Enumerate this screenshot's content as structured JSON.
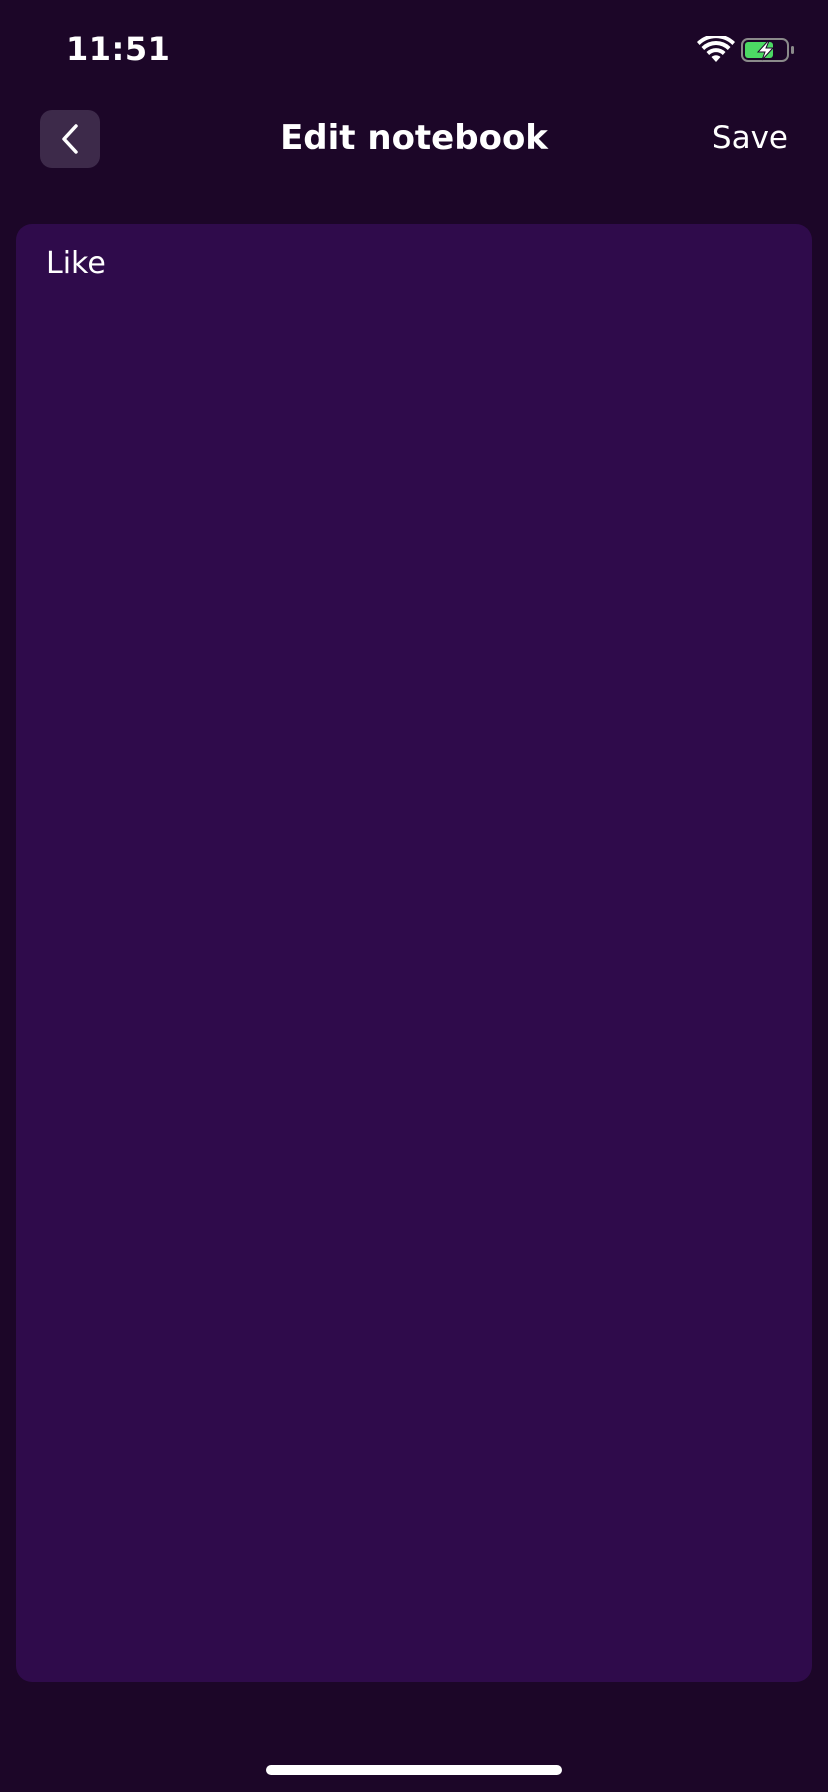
{
  "status_bar": {
    "time": "11:51",
    "wifi_icon": "wifi-icon",
    "battery_icon": "battery-charging-icon",
    "battery_color": "#4cd964"
  },
  "nav": {
    "back_icon": "chevron-left-icon",
    "title": "Edit notebook",
    "save_label": "Save"
  },
  "editor": {
    "text": "Like",
    "background": "#2f0b4b"
  },
  "colors": {
    "background": "#1c0628",
    "card": "#2f0b4b",
    "back_button": "#3d2a4a"
  }
}
